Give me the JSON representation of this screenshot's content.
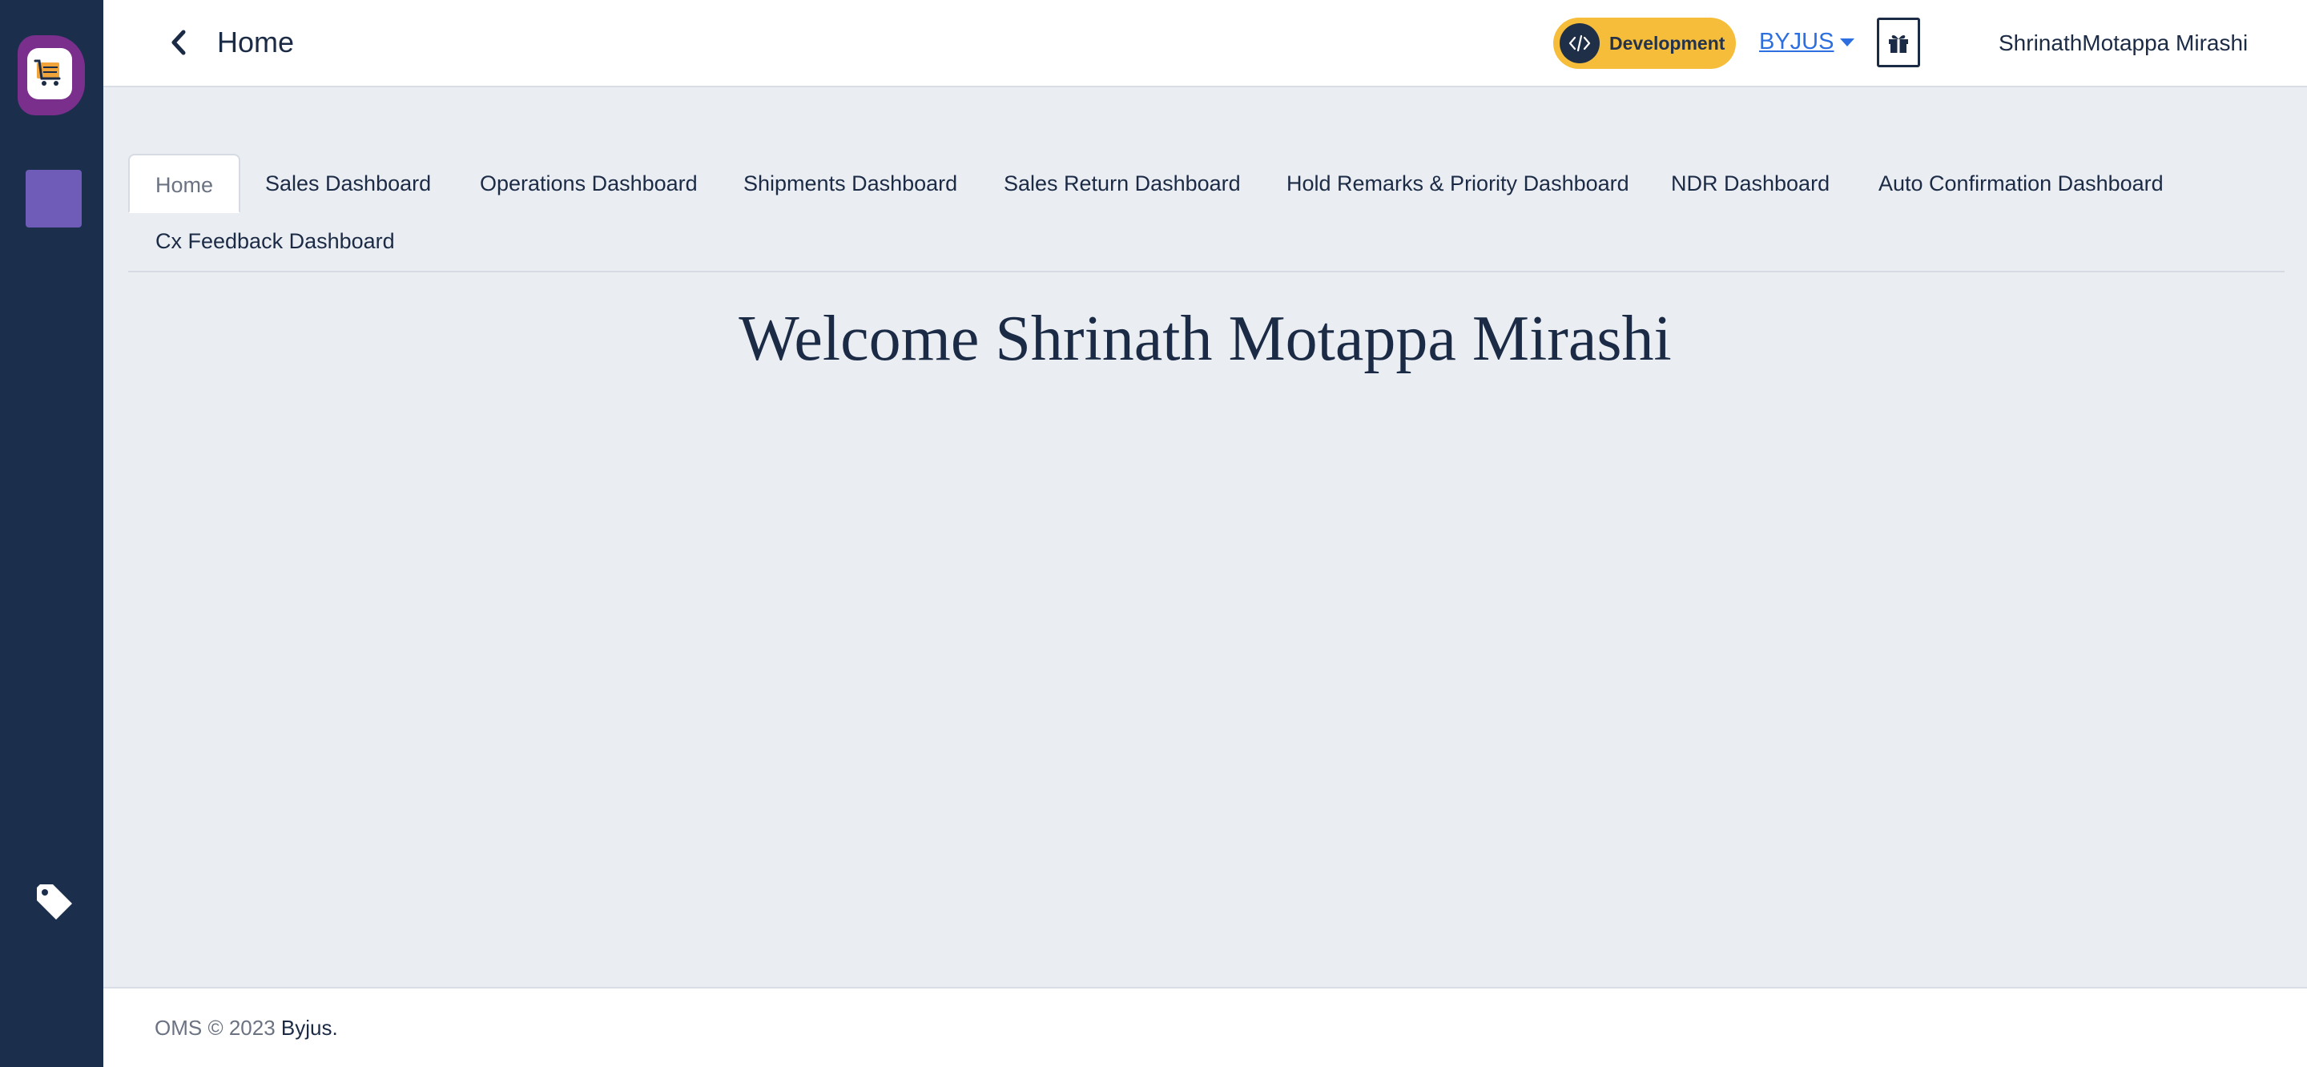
{
  "header": {
    "title": "Home",
    "environment": "Development",
    "organization": "BYJUS",
    "user_name": "ShrinathMotappa Mirashi"
  },
  "tabs": [
    {
      "label": "Home",
      "active": true
    },
    {
      "label": "Sales Dashboard",
      "active": false
    },
    {
      "label": "Operations Dashboard",
      "active": false
    },
    {
      "label": "Shipments Dashboard",
      "active": false
    },
    {
      "label": "Sales Return Dashboard",
      "active": false
    },
    {
      "label": "Hold Remarks & Priority Dashboard",
      "active": false
    },
    {
      "label": "NDR Dashboard",
      "active": false
    },
    {
      "label": "Auto Confirmation Dashboard",
      "active": false
    },
    {
      "label": "Cx Feedback Dashboard",
      "active": false
    }
  ],
  "main": {
    "welcome": "Welcome Shrinath Motappa Mirashi"
  },
  "footer": {
    "prefix": "OMS © 2023 ",
    "brand": "Byjus."
  },
  "icons": {
    "sidebar_logo": "cart-logo-icon",
    "sidebar_nav": "nav-square-icon",
    "sidebar_tag": "tag-icon",
    "back": "chevron-left-icon",
    "environment": "code-icon",
    "gift": "gift-icon"
  },
  "colors": {
    "sidebar": "#1b2f4c",
    "background": "#eaedf2",
    "environment_pill": "#f5bd3a",
    "link": "#2d6fe0",
    "logo": "#7b2f8d",
    "nav_square": "#6f5bb8"
  }
}
